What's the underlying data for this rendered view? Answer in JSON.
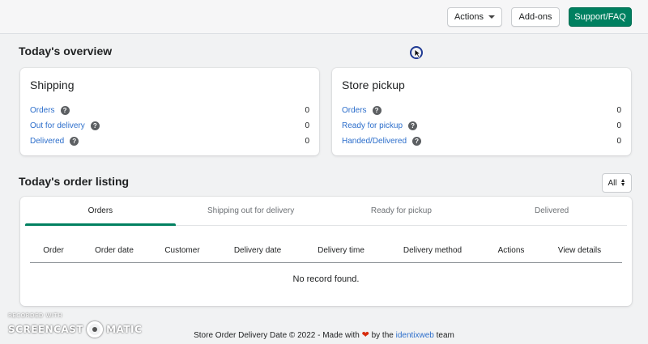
{
  "toolbar": {
    "actions_label": "Actions",
    "addons_label": "Add-ons",
    "support_label": "Support/FAQ"
  },
  "overview": {
    "title": "Today's overview",
    "shipping": {
      "title": "Shipping",
      "rows": [
        {
          "label": "Orders",
          "value": "0"
        },
        {
          "label": "Out for delivery",
          "value": "0"
        },
        {
          "label": "Delivered",
          "value": "0"
        }
      ]
    },
    "pickup": {
      "title": "Store pickup",
      "rows": [
        {
          "label": "Orders",
          "value": "0"
        },
        {
          "label": "Ready for pickup",
          "value": "0"
        },
        {
          "label": "Handed/Delivered",
          "value": "0"
        }
      ]
    }
  },
  "listing": {
    "title": "Today's order listing",
    "filter_value": "All",
    "tabs": [
      "Orders",
      "Shipping out for delivery",
      "Ready for pickup",
      "Delivered"
    ],
    "columns": [
      "Order",
      "Order date",
      "Customer",
      "Delivery date",
      "Delivery time",
      "Delivery method",
      "Actions",
      "View details"
    ],
    "empty_message": "No record found."
  },
  "footer": {
    "prefix": "Store Order Delivery Date © 2022 - Made with",
    "by": "by the",
    "brand": "identixweb",
    "suffix": "team"
  },
  "watermark": {
    "top": "RECORDED WITH",
    "left": "SCREENCAST",
    "right": "MATIC"
  },
  "colors": {
    "accent": "#008060",
    "link": "#2c6ecb",
    "heart": "#d72c0d"
  }
}
